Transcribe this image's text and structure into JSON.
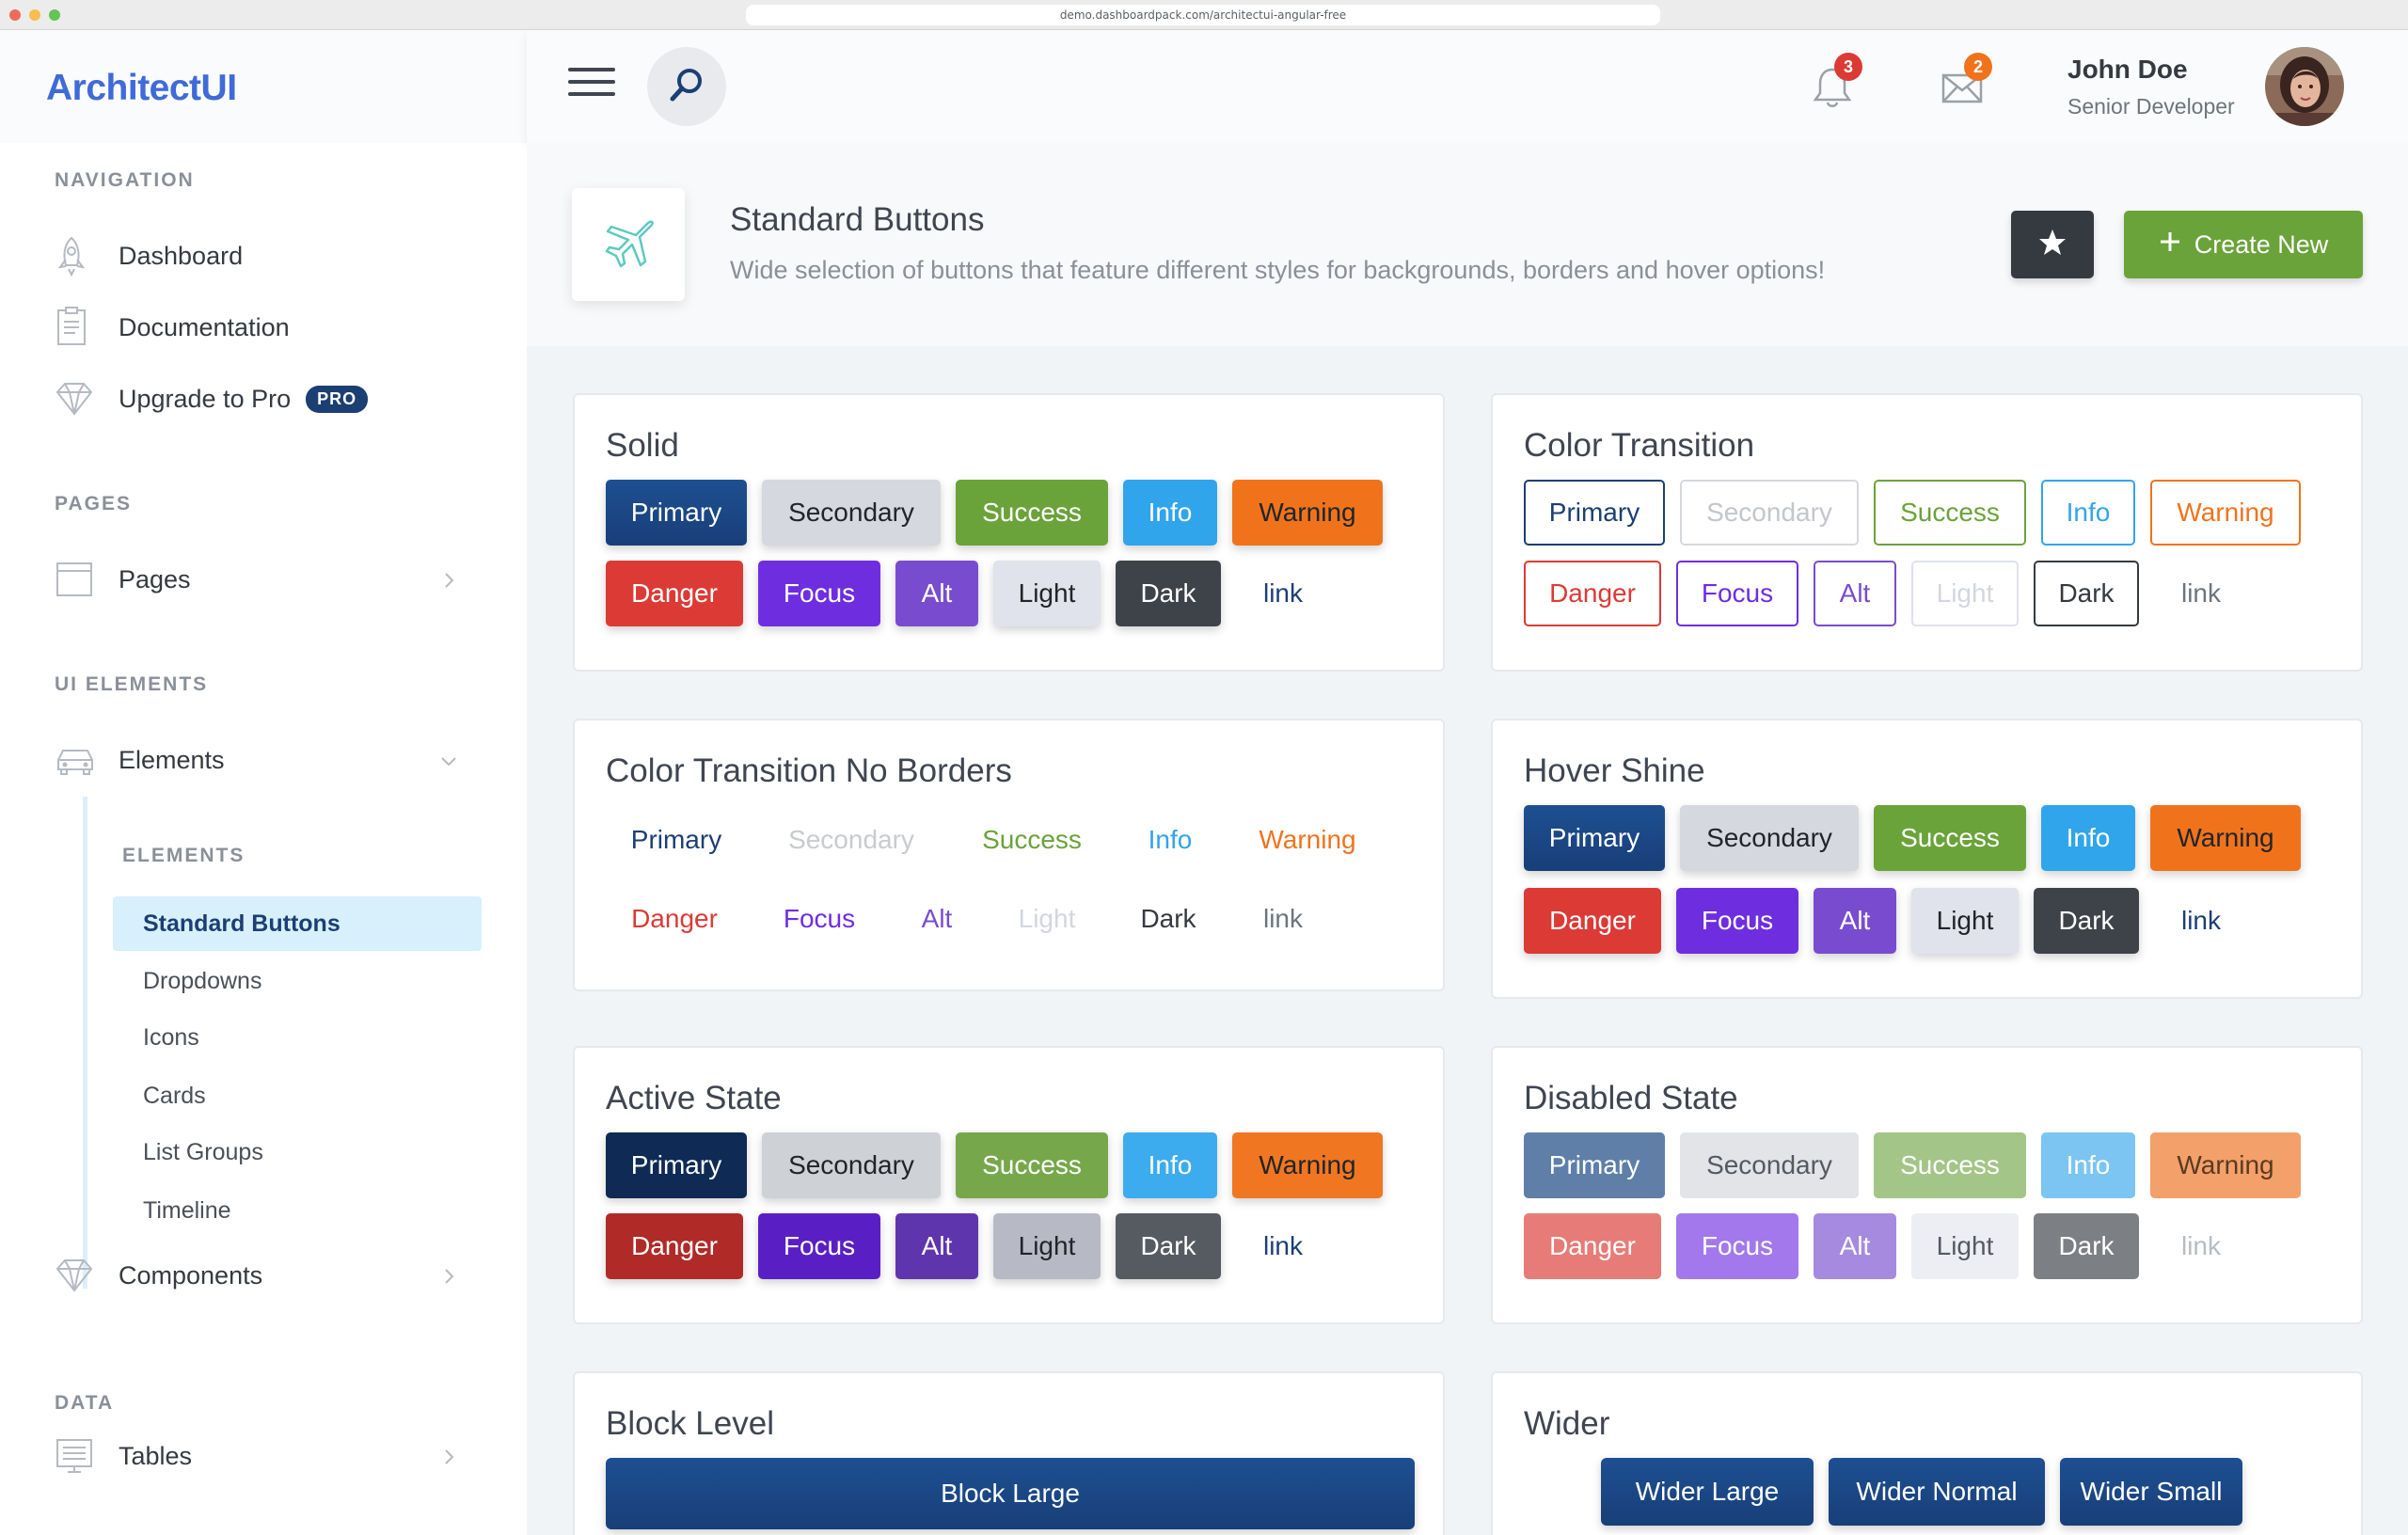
{
  "browser": {
    "url": "demo.dashboardpack.com/architectui-angular-free"
  },
  "logo": "ArchitectUI",
  "sidebar": {
    "sections": {
      "navigation": "NAVIGATION",
      "pages": "PAGES",
      "ui_elements": "UI ELEMENTS",
      "elements_sub": "ELEMENTS",
      "data": "DATA"
    },
    "items": {
      "dashboard": "Dashboard",
      "documentation": "Documentation",
      "upgrade": "Upgrade to Pro",
      "pro_badge": "PRO",
      "pages": "Pages",
      "elements": "Elements",
      "components": "Components",
      "tables": "Tables"
    },
    "sub_items": [
      "Standard Buttons",
      "Dropdowns",
      "Icons",
      "Cards",
      "List Groups",
      "Timeline"
    ],
    "active_sub_item": "Standard Buttons"
  },
  "header": {
    "notifications_count": "3",
    "messages_count": "2",
    "user_name": "John Doe",
    "user_role": "Senior Developer"
  },
  "page_title": {
    "heading": "Standard Buttons",
    "subheading": "Wide selection of buttons that feature different styles for backgrounds, borders and hover options!",
    "create_label": "Create New"
  },
  "button_labels": {
    "primary": "Primary",
    "secondary": "Secondary",
    "success": "Success",
    "info": "Info",
    "warning": "Warning",
    "danger": "Danger",
    "focus": "Focus",
    "alt": "Alt",
    "light": "Light",
    "dark": "Dark",
    "link": "link"
  },
  "cards": {
    "solid": "Solid",
    "color_transition": "Color Transition",
    "no_borders": "Color Transition No Borders",
    "hover_shine": "Hover Shine",
    "active_state": "Active State",
    "disabled_state": "Disabled State",
    "block_level": "Block Level",
    "wider": "Wider"
  },
  "block_level": {
    "block_large": "Block Large"
  },
  "wider": {
    "large": "Wider Large",
    "normal": "Wider Normal",
    "small": "Wider Small"
  },
  "colors": {
    "brand": "#3f6ad8",
    "primary": "#1c3f73",
    "success": "#6aa33a",
    "info": "#30a5ec",
    "warning": "#f0731c",
    "danger": "#dc3a35",
    "focus": "#6f2de0",
    "alt": "#794ccf",
    "dark": "#343a40"
  },
  "icons": [
    "menu-icon",
    "search-icon",
    "bell-icon",
    "envelope-icon",
    "rocket-icon",
    "document-icon",
    "diamond-icon",
    "browser-icon",
    "car-icon",
    "monitor-icon",
    "chevron-right-icon",
    "chevron-down-icon",
    "plane-icon",
    "star-icon",
    "plus-icon"
  ]
}
